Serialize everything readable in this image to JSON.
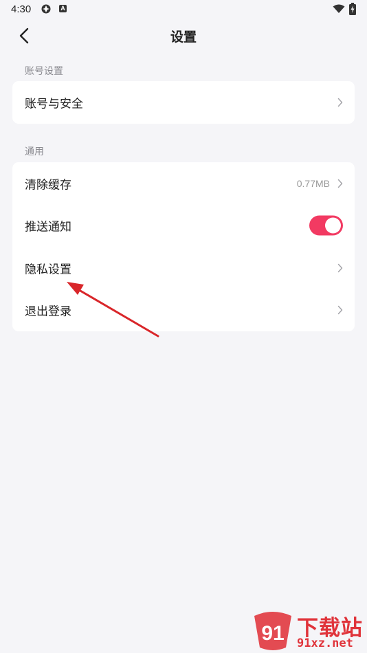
{
  "status_bar": {
    "time": "4:30",
    "notification_icon": "app-notification-icon",
    "badge_icon_letter": "A",
    "wifi_icon": "wifi-icon",
    "battery_icon": "battery-charging-icon"
  },
  "header": {
    "back_icon": "chevron-left-icon",
    "title": "设置"
  },
  "sections": {
    "account": {
      "label": "账号设置",
      "items": [
        {
          "label": "账号与安全"
        }
      ]
    },
    "general": {
      "label": "通用",
      "items": [
        {
          "label": "清除缓存",
          "value": "0.77MB"
        },
        {
          "label": "推送通知",
          "toggle_on": true
        },
        {
          "label": "隐私设置"
        },
        {
          "label": "退出登录"
        }
      ]
    }
  },
  "colors": {
    "accent": "#f23a62",
    "background": "#f5f5f8",
    "annotation_arrow": "#d9262a"
  },
  "watermark": {
    "title": "下载站",
    "url": "91xz.net",
    "logo_text": "91"
  }
}
